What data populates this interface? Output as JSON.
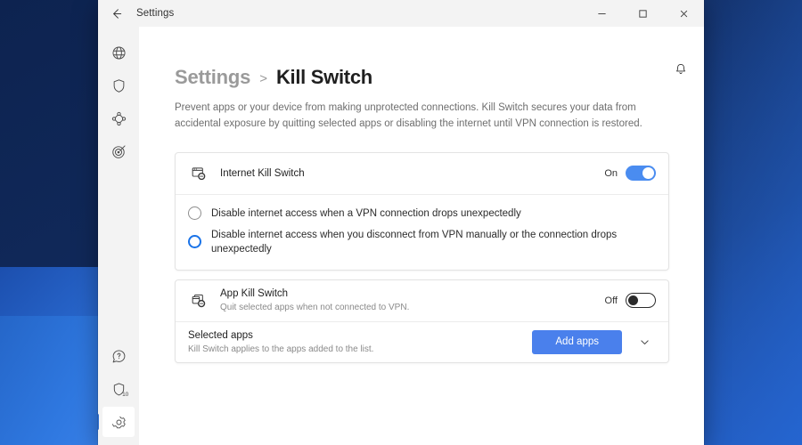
{
  "desktop": {
    "wallpaper_colors": [
      "#0d2350",
      "#1f4ea8",
      "#3b82ea"
    ]
  },
  "window": {
    "titlebar": {
      "back_label": "back-arrow",
      "title": "Settings",
      "minimize_label": "Minimize",
      "maximize_label": "Maximize",
      "close_label": "Close"
    }
  },
  "rail": {
    "top_items": [
      {
        "name": "globe",
        "label": "VPN Locations"
      },
      {
        "name": "shield",
        "label": "Protection"
      },
      {
        "name": "mesh",
        "label": "Mesh Network"
      },
      {
        "name": "target",
        "label": "Threat Protection"
      }
    ],
    "bottom_items": [
      {
        "name": "help",
        "label": "Help",
        "badge": ""
      },
      {
        "name": "shield-badge",
        "label": "Notifications",
        "badge": "10"
      },
      {
        "name": "gear",
        "label": "Settings",
        "badge": "",
        "active": true
      }
    ]
  },
  "header": {
    "notification_icon": "bell-icon"
  },
  "breadcrumb": {
    "parent": "Settings",
    "separator": ">",
    "current": "Kill Switch"
  },
  "page": {
    "description": "Prevent apps or your device from making unprotected connections. Kill Switch secures your data from accidental exposure by quitting selected apps or disabling the internet until VPN connection is restored."
  },
  "internet_kill_switch": {
    "icon": "browser-block-icon",
    "title": "Internet Kill Switch",
    "toggle_state_label": "On",
    "toggle_on": true,
    "accent_color": "#4a8cf0",
    "options": [
      {
        "label": "Disable internet access when a VPN connection drops unexpectedly",
        "selected": false
      },
      {
        "label": "Disable internet access when you disconnect from VPN manually or the connection drops unexpectedly",
        "selected": true
      }
    ]
  },
  "app_kill_switch": {
    "icon": "app-block-icon",
    "title": "App Kill Switch",
    "subtitle": "Quit selected apps when not connected to VPN.",
    "toggle_state_label": "Off",
    "toggle_on": false,
    "selected_apps": {
      "title": "Selected apps",
      "subtitle": "Kill Switch applies to the apps added to the list.",
      "add_button_label": "Add apps",
      "add_button_color": "#4a80ec",
      "expand_icon": "chevron-down-icon"
    }
  }
}
